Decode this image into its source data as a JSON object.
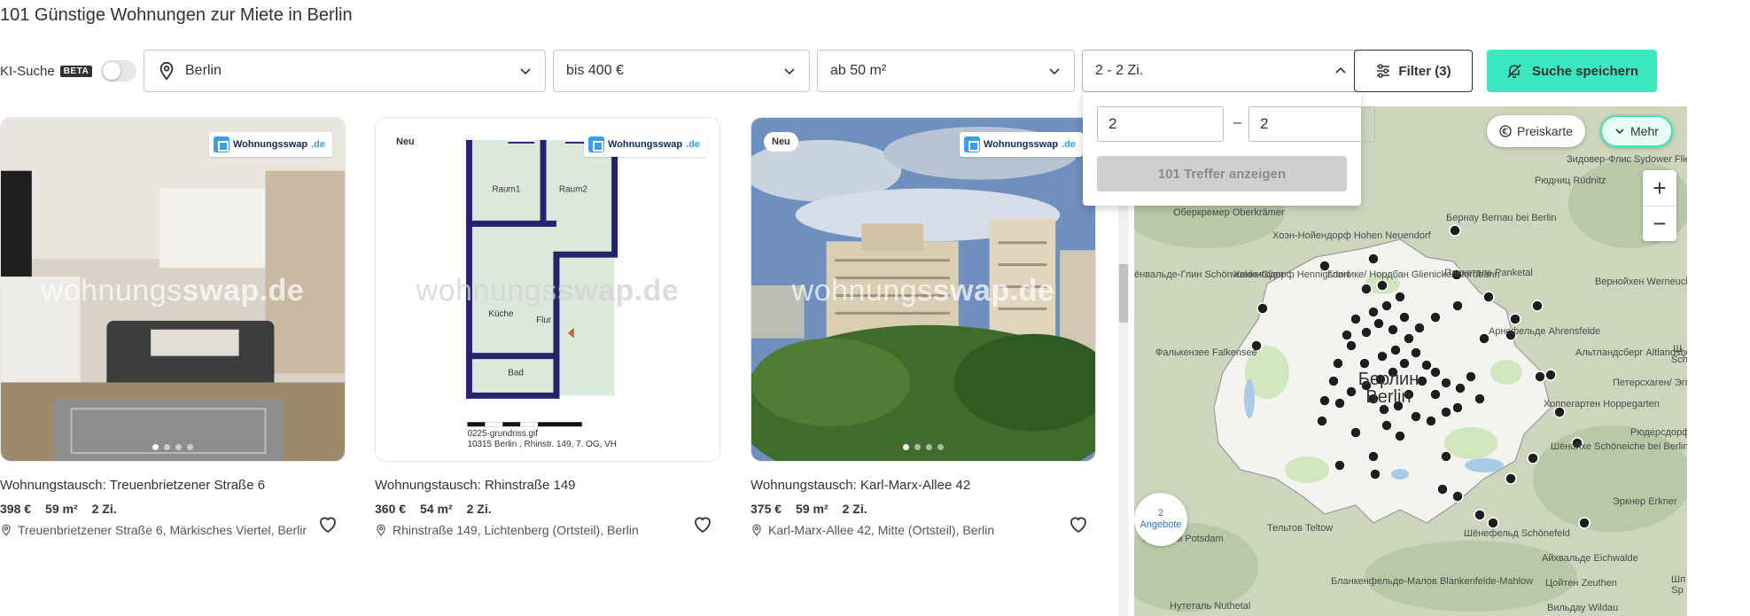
{
  "page": {
    "title": "101  Günstige Wohnungen zur Miete in Berlin"
  },
  "filters": {
    "ki_label": "KI-Suche",
    "beta_label": "BETA",
    "location": "Berlin",
    "price": "bis 400 €",
    "area": "ab 50 m²",
    "rooms": "2 - 2 Zi.",
    "filter_button": "Filter (3)",
    "save_button": "Suche speichern"
  },
  "rooms_dropdown": {
    "min": "2",
    "separator": "–",
    "max": "2",
    "show_button": "101 Treffer anzeigen"
  },
  "listings": [
    {
      "logo_text": "Wohnungsswap",
      "logo_suffix": ".de",
      "watermark_a": "wohnungs",
      "watermark_b": "swap.de",
      "title": "Wohnungstausch: Treuenbrietzener Straße 6",
      "price": "398 €",
      "area": "59 m²",
      "rooms": "2 Zi.",
      "address": "Treuenbrietzener Straße 6, Märkisches Viertel, Berlin"
    },
    {
      "badge": "Neu",
      "logo_text": "Wohnungsswap",
      "logo_suffix": ".de",
      "watermark_a": "wohnungs",
      "watermark_b": "swap.de",
      "plan_labels": [
        "Raum1",
        "Raum2",
        "Küche",
        "Flur",
        "Bad"
      ],
      "plan_caption_1": "0225-grundriss.gif",
      "plan_caption_2": "10315 Berlin , Rhinstr. 149, 7. OG, VH",
      "title": "Wohnungstausch: Rhinstraße 149",
      "price": "360 €",
      "area": "54 m²",
      "rooms": "2 Zi.",
      "address": "Rhinstraße 149, Lichtenberg (Ortsteil), Berlin"
    },
    {
      "badge": "Neu",
      "logo_text": "Wohnungsswap",
      "logo_suffix": ".de",
      "watermark_a": "wohnungs",
      "watermark_b": "swap.de",
      "title": "Wohnungstausch: Karl-Marx-Allee 42",
      "price": "375 €",
      "area": "59 m²",
      "rooms": "2 Zi.",
      "address": "Karl-Marx-Allee 42, Mitte (Ortsteil), Berlin"
    }
  ],
  "map": {
    "preiskarte": "Preiskarte",
    "mehr": "Mehr",
    "zoom_in": "+",
    "zoom_out": "−",
    "cluster_count": "2",
    "cluster_label": "Angebote",
    "places": [
      "Зидовер-Флис Sydower Fließ",
      "Рюдниц Rüdnitz",
      "Оберкремер Oberkrämer",
      "Хоэн-Нойендорф Hohen Neuendorf",
      "Бернау Bernau bei Berlin",
      "Панкеталь Panketal",
      "Шёнвальде-Глин Schönwalde-Glien",
      "Хеннигсдорф Hennigsdorf",
      "Глинике/ Нордбан Glienicke/ Nordbahn",
      "Вернойхен Werneuchen",
      "Арнсфельде Ahrensfelde",
      "Альтландсберг Altlandsberg",
      "Фалькензее Falkensee",
      "Берлин Berlin",
      "Петерсхаген/ Эггерсдорф Petershagen/ Eggersdorf",
      "Хоппегартен Hoppegarten",
      "Шёнайхе Schöneiche bei Berlin",
      "Рюдерсдорф Rüdersdorf bei Berlin",
      "Тельтов Teltow",
      "Потсдам Potsdam",
      "Шёнефельд Schönefeld",
      "Айхвальде Eichwalde",
      "Цойтен Zeuthen",
      "Эркнер Erkner",
      "Бланкенфельде-Малов Blankenfelde-Mahlow",
      "Нутеталь Nuthetal",
      "Вильдау Wildau",
      "Шп Sp",
      "Ш Sch"
    ]
  }
}
